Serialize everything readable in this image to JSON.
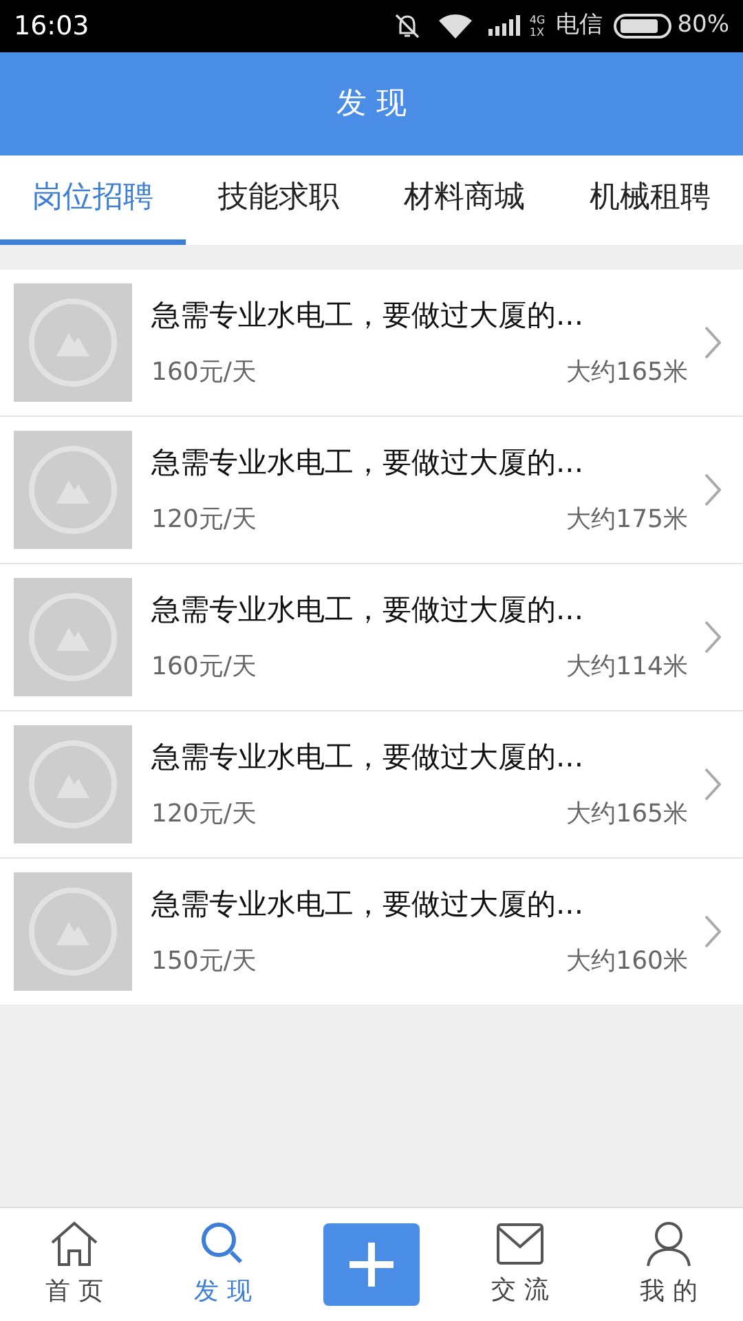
{
  "status_bar": {
    "time": "16:03",
    "network": "4G\n1X",
    "carrier": "电信",
    "battery": "80%"
  },
  "header": {
    "title": "发 现"
  },
  "tabs": [
    {
      "label": "岗位招聘",
      "selected": true
    },
    {
      "label": "技能求职",
      "selected": false
    },
    {
      "label": "材料商城",
      "selected": false
    },
    {
      "label": "机械租聘",
      "selected": false
    }
  ],
  "listings": [
    {
      "title": "急需专业水电工，要做过大厦的...",
      "pay": "160元/天",
      "distance": "大约165米"
    },
    {
      "title": "急需专业水电工，要做过大厦的...",
      "pay": "120元/天",
      "distance": "大约175米"
    },
    {
      "title": "急需专业水电工，要做过大厦的...",
      "pay": "160元/天",
      "distance": "大约114米"
    },
    {
      "title": "急需专业水电工，要做过大厦的...",
      "pay": "120元/天",
      "distance": "大约165米"
    },
    {
      "title": "急需专业水电工，要做过大厦的...",
      "pay": "150元/天",
      "distance": "大约160米"
    }
  ],
  "bottom_nav": [
    {
      "kind": "home",
      "label": "首 页",
      "selected": false
    },
    {
      "kind": "search",
      "label": "发 现",
      "selected": true
    },
    {
      "kind": "add"
    },
    {
      "kind": "mail",
      "label": "交 流",
      "selected": false
    },
    {
      "kind": "user",
      "label": "我 的",
      "selected": false
    }
  ]
}
